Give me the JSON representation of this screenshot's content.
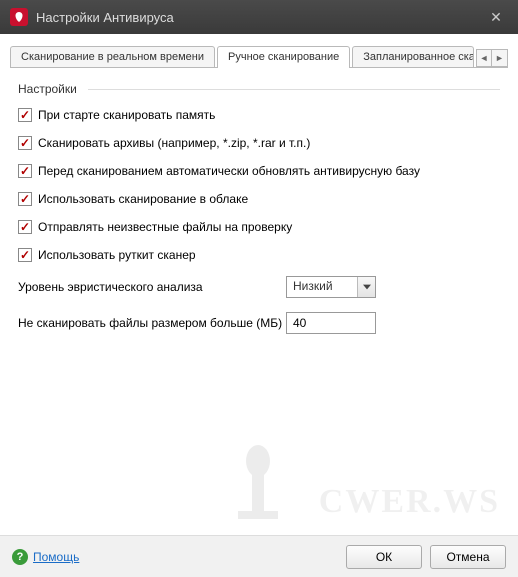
{
  "titlebar": {
    "title": "Настройки Антивируса"
  },
  "tabs": {
    "t0": "Сканирование в реальном времени",
    "t1": "Ручное сканирование",
    "t2": "Запланированное сканиров"
  },
  "group": {
    "label": "Настройки"
  },
  "checks": {
    "c0": "При старте сканировать память",
    "c1": "Сканировать архивы (например, *.zip, *.rar и т.п.)",
    "c2": "Перед сканированием автоматически обновлять антивирусную базу",
    "c3": "Использовать сканирование в облаке",
    "c4": "Отправлять неизвестные файлы на проверку",
    "c5": "Использовать руткит сканер"
  },
  "heuristic": {
    "label": "Уровень эвристического анализа",
    "value": "Низкий"
  },
  "maxsize": {
    "label": "Не сканировать файлы размером больше (МБ)",
    "value": "40"
  },
  "footer": {
    "help": "Помощь",
    "ok": "ОК",
    "cancel": "Отмена"
  },
  "watermark": "CWER.WS"
}
